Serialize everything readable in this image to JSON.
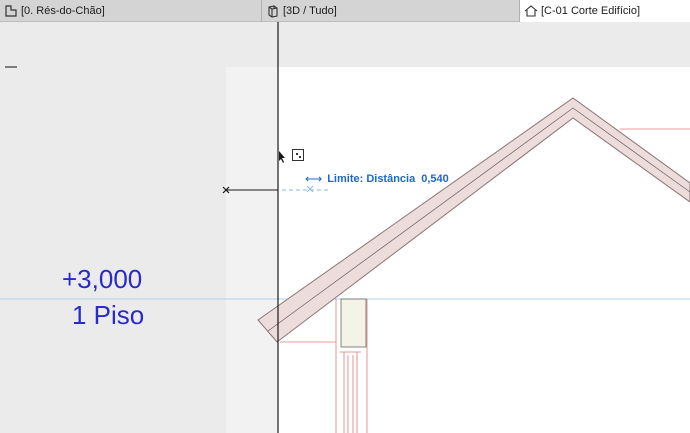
{
  "tabs": [
    {
      "label": "[0. Rés-do-Chão]",
      "icon": "floor-plan-icon",
      "active": false
    },
    {
      "label": "[3D / Tudo]",
      "icon": "3d-view-icon",
      "active": false
    },
    {
      "label": "[C-01 Corte Edifício]",
      "icon": "section-view-icon",
      "active": true
    }
  ],
  "level_marker": {
    "value": "+3,000",
    "name": "1 Piso",
    "color": "#2a2acc"
  },
  "tracker": {
    "label": "Limite: Distância",
    "value": "0,540",
    "icon": "horizontal-arrow-icon",
    "color": "#1f68c8"
  },
  "colors": {
    "roof_fill": "#ecdcdc",
    "roof_stroke": "#8a7474",
    "guide_line": "#a8d4f0",
    "red_lines": "#e07a7a"
  }
}
